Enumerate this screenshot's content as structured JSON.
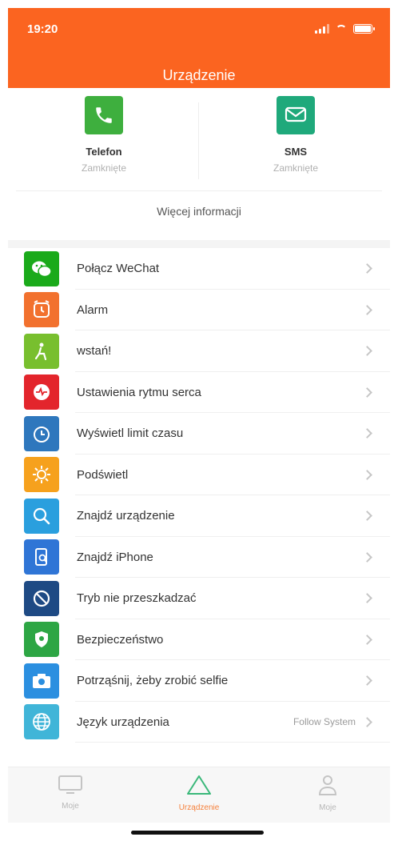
{
  "status_bar": {
    "time": "19:20"
  },
  "header": {
    "title": "Urządzenie"
  },
  "notifications": [
    {
      "name": "Telefon",
      "status": "Zamknięte",
      "icon": "phone-icon",
      "color": "#3eaf3e"
    },
    {
      "name": "SMS",
      "status": "Zamknięte",
      "icon": "message-icon",
      "color": "#1fa97b"
    }
  ],
  "more_info": "Więcej informacji",
  "settings": [
    {
      "label": "Połącz WeChat",
      "value": "",
      "icon": "wechat-icon",
      "color": "#1aaa1a"
    },
    {
      "label": "Alarm",
      "value": "",
      "icon": "alarm-icon",
      "color": "#f2712e"
    },
    {
      "label": "wstań!",
      "value": "",
      "icon": "sedentary-icon",
      "color": "#78bf2e"
    },
    {
      "label": "Ustawienia rytmu serca",
      "value": "",
      "icon": "heart-rate-icon",
      "color": "#e3252c"
    },
    {
      "label": "Wyświetl limit czasu",
      "value": "",
      "icon": "timer-icon",
      "color": "#2e77bd"
    },
    {
      "label": "Podświetl",
      "value": "",
      "icon": "backlight-icon",
      "color": "#f6a11d"
    },
    {
      "label": "Znajdź urządzenie",
      "value": "",
      "icon": "find-device-icon",
      "color": "#2a9fde"
    },
    {
      "label": "Znajdź iPhone",
      "value": "",
      "icon": "find-iphone-icon",
      "color": "#2f75d6"
    },
    {
      "label": "Tryb nie przeszkadzać",
      "value": "",
      "icon": "do-not-disturb-icon",
      "color": "#1e4a84"
    },
    {
      "label": "Bezpieczeństwo",
      "value": "",
      "icon": "security-icon",
      "color": "#2da644"
    },
    {
      "label": "Potrząśnij, żeby zrobić selfie",
      "value": "",
      "icon": "camera-icon",
      "color": "#2b8fe0"
    },
    {
      "label": "Język urządzenia",
      "value": "Follow System",
      "icon": "language-icon",
      "color": "#40b5d8"
    }
  ],
  "tabs": [
    {
      "label": "Moje",
      "icon": "screen-icon",
      "active": false
    },
    {
      "label": "Urządzenie",
      "icon": "triangle-icon",
      "active": true
    },
    {
      "label": "Moje",
      "icon": "user-icon",
      "active": false
    }
  ],
  "colors": {
    "accent": "#fb6420",
    "tab_active": "#f6813c"
  }
}
